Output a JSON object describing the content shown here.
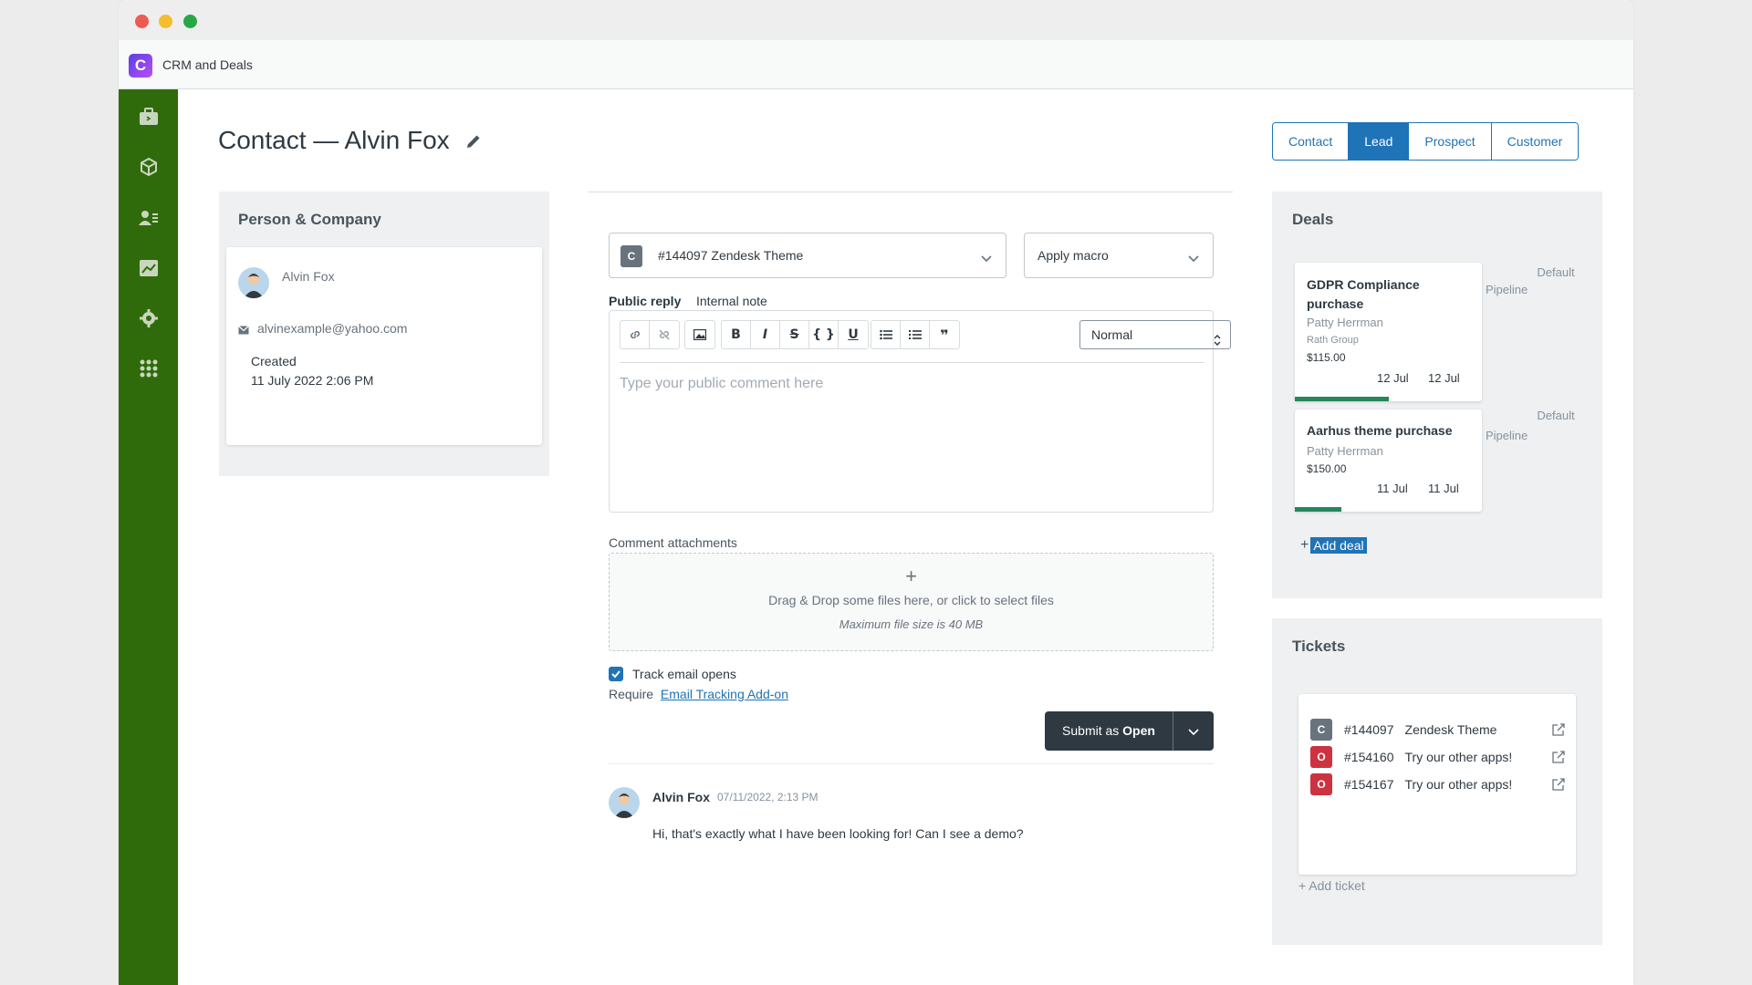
{
  "app": {
    "title": "CRM and Deals",
    "logo_letter": "C"
  },
  "sidebar": {
    "icons": [
      "briefcase-icon",
      "box-icon",
      "contacts-icon",
      "reports-icon",
      "settings-gear-icon",
      "apps-grid-icon"
    ]
  },
  "page": {
    "title": "Contact — Alvin Fox"
  },
  "status_tabs": [
    {
      "label": "Contact",
      "active": false
    },
    {
      "label": "Lead",
      "active": true
    },
    {
      "label": "Prospect",
      "active": false
    },
    {
      "label": "Customer",
      "active": false
    }
  ],
  "person": {
    "panel_title": "Person & Company",
    "name": "Alvin Fox",
    "email": "alvinexample@yahoo.com",
    "created_label": "Created",
    "created_value": "11 July 2022 2:06 PM"
  },
  "composer": {
    "ticket_select": {
      "chip": "C",
      "value": "#144097 Zendesk Theme"
    },
    "macro_select": {
      "value": "Apply macro"
    },
    "tabs": {
      "public_reply": "Public reply",
      "internal_note": "Internal note"
    },
    "format_select": "Normal",
    "placeholder": "Type your public comment here",
    "attachments_label": "Comment attachments",
    "dropzone_plus": "+",
    "dropzone_text": "Drag & Drop some files here, or click to select files",
    "dropzone_hint": "Maximum file size is 40 MB",
    "track_label": "Track email opens",
    "require_text": "Require",
    "require_link": "Email Tracking Add-on",
    "submit_prefix": "Submit as",
    "submit_status": "Open"
  },
  "comment": {
    "author": "Alvin Fox",
    "timestamp": "07/11/2022, 2:13 PM",
    "text": "Hi, that's exactly what I have been looking for! Can I see a demo?"
  },
  "deals": {
    "title": "Deals",
    "items": [
      {
        "name_line1": "GDPR Compliance",
        "name_line2": "purchase",
        "person": "Patty Herrman",
        "company": "Rath Group",
        "amount": "$115.00",
        "date1": "12 Jul",
        "date2": "12 Jul",
        "pipeline1": "Default",
        "pipeline2": "Pipeline",
        "progress": 0.5
      },
      {
        "name_line1": "Aarhus theme purchase",
        "person": "Patty Herrman",
        "amount": "$150.00",
        "date1": "11 Jul",
        "date2": "11 Jul",
        "pipeline1": "Default",
        "pipeline2": "Pipeline",
        "progress": 0.25
      }
    ],
    "add_plus": "+",
    "add_label": "Add deal"
  },
  "tickets": {
    "title": "Tickets",
    "items": [
      {
        "chip": "C",
        "id": "#144097",
        "subject": "Zendesk Theme"
      },
      {
        "chip": "O",
        "id": "#154160",
        "subject": "Try our other apps!"
      },
      {
        "chip": "O",
        "id": "#154167",
        "subject": "Try our other apps!"
      }
    ],
    "add_label": "+ Add ticket"
  },
  "colors": {
    "sidebar": "#2f6b0a",
    "accent": "#1f73b7",
    "deal_progress": "#26875b",
    "open_chip": "#cc3340",
    "closed_chip": "#68737d"
  }
}
